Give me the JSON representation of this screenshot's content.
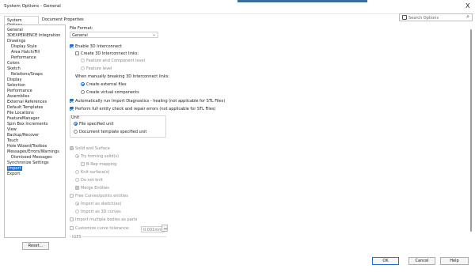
{
  "window": {
    "title": "System Options - General",
    "close_glyph": "X"
  },
  "tabs": [
    "System Options",
    "Document Properties"
  ],
  "search": {
    "placeholder": "Search Options",
    "icon": "search-options-icon"
  },
  "tree": [
    {
      "label": "General",
      "level": 0
    },
    {
      "label": "3DEXPERIENCE Integration",
      "level": 0
    },
    {
      "label": "Drawings",
      "level": 0
    },
    {
      "label": "Display Style",
      "level": 1
    },
    {
      "label": "Area Hatch/Fill",
      "level": 1
    },
    {
      "label": "Performance",
      "level": 1
    },
    {
      "label": "Colors",
      "level": 0
    },
    {
      "label": "Sketch",
      "level": 0
    },
    {
      "label": "Relations/Snaps",
      "level": 1
    },
    {
      "label": "Display",
      "level": 0
    },
    {
      "label": "Selection",
      "level": 0
    },
    {
      "label": "Performance",
      "level": 0
    },
    {
      "label": "Assemblies",
      "level": 0
    },
    {
      "label": "External References",
      "level": 0
    },
    {
      "label": "Default Templates",
      "level": 0
    },
    {
      "label": "File Locations",
      "level": 0
    },
    {
      "label": "FeatureManager",
      "level": 0
    },
    {
      "label": "Spin Box Increments",
      "level": 0
    },
    {
      "label": "View",
      "level": 0
    },
    {
      "label": "Backup/Recover",
      "level": 0
    },
    {
      "label": "Touch",
      "level": 0
    },
    {
      "label": "Hole Wizard/Toolbox",
      "level": 0
    },
    {
      "label": "Messages/Errors/Warnings",
      "level": 0
    },
    {
      "label": "Dismissed Messages",
      "level": 1
    },
    {
      "label": "Synchronize Settings",
      "level": 0
    },
    {
      "label": "Import",
      "level": 0,
      "selected": true
    },
    {
      "label": "Export",
      "level": 0
    }
  ],
  "reset_label": "Reset...",
  "content": {
    "file_format_label": "File Format:",
    "file_format_value": "General",
    "enable_3d_interconnect": "Enable 3D Interconnect",
    "create_3d_links": "Create 3D Interconnect links:",
    "feature_component_level": "Feature and Component level",
    "feature_level": "Feature level",
    "breaking_label": "When manually breaking 3D Interconnect links:",
    "create_external_files": "Create external files",
    "create_virtual_components": "Create virtual components",
    "auto_run_diagnostics": "Automatically run Import Diagnostics - healing (not applicable for STL Files)",
    "full_entity_check": "Perform full entity check and repair errors (not applicable for STL Files)",
    "unit_label": "Unit",
    "file_specified_unit": "File specified unit",
    "document_template_unit": "Document template specified unit",
    "solid_and_surface": "Solid and Surface",
    "try_forming_solids": "Try forming solid(s)",
    "b_rep_mapping": "B-Rep mapping",
    "knit_surfaces": "Knit surface(s)",
    "do_not_knit": "Do not knit",
    "merge_entities": "Merge Entities",
    "free_curves": "Free Curves/points entities",
    "import_as_sketch": "Import as sketch(es)",
    "import_as_3d_curves": "Import as 3D curves",
    "import_multiple_bodies": "Import multiple bodies as parts",
    "customize_tolerance": "Customize curve tolerance:",
    "tolerance_value": "0.001mm",
    "iges_label": "IGES"
  },
  "buttons": {
    "ok": "OK",
    "cancel": "Cancel",
    "help": "Help"
  },
  "colors": {
    "accent": "#1f6fd1",
    "title_strip": "#3a6d9c"
  }
}
